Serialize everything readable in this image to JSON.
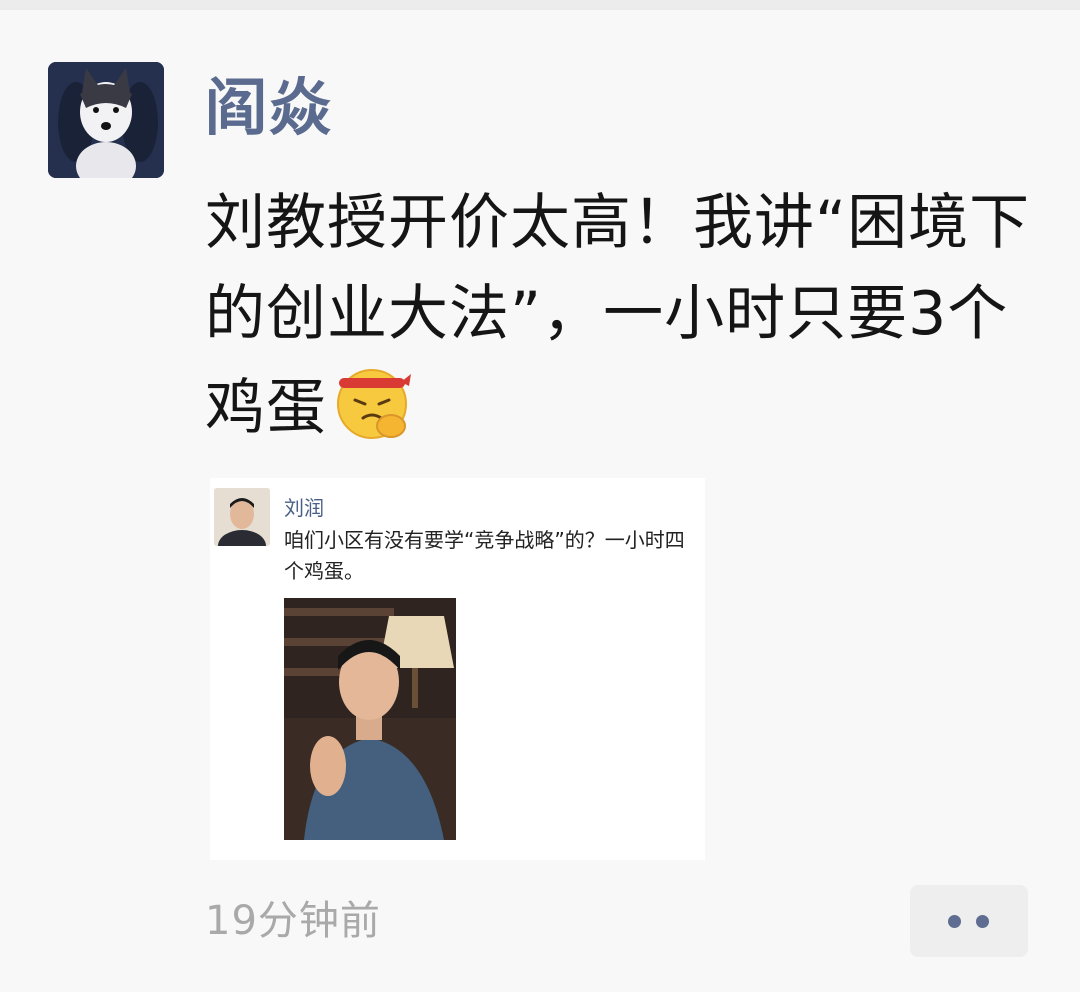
{
  "post": {
    "username": "阎焱",
    "text": "刘教授开价太高！我讲“困境下的创业大法”，一小时只要3个鸡蛋",
    "emoji": "angry-headband-face-emoji",
    "timestamp": "19分钟前"
  },
  "shared": {
    "author": "刘润",
    "text": "咱们小区有没有要学“竞争战略”的？一小时四个鸡蛋。"
  },
  "icons": {
    "avatar": "husky-avatar",
    "more": "more-dots-icon"
  },
  "colors": {
    "username": "#5b6b8f",
    "timestamp": "#a9a9a9",
    "link": "#4a5f86",
    "dots": "#5e6d91"
  }
}
